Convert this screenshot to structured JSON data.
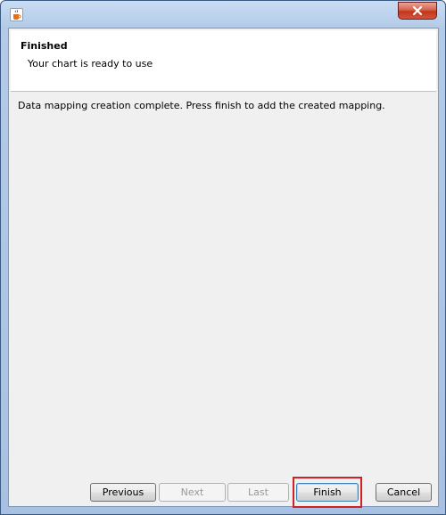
{
  "window": {
    "icon": "java-cup-icon",
    "close_icon": "close-icon"
  },
  "header": {
    "title": "Finished",
    "subtitle": "Your chart is ready to use"
  },
  "main": {
    "message": "Data mapping creation complete.  Press finish to add the created mapping."
  },
  "buttons": {
    "previous": "Previous",
    "next": "Next",
    "last": "Last",
    "finish": "Finish",
    "cancel": "Cancel"
  },
  "colors": {
    "highlight": "#d31f26",
    "close_button": "#c5341c"
  }
}
